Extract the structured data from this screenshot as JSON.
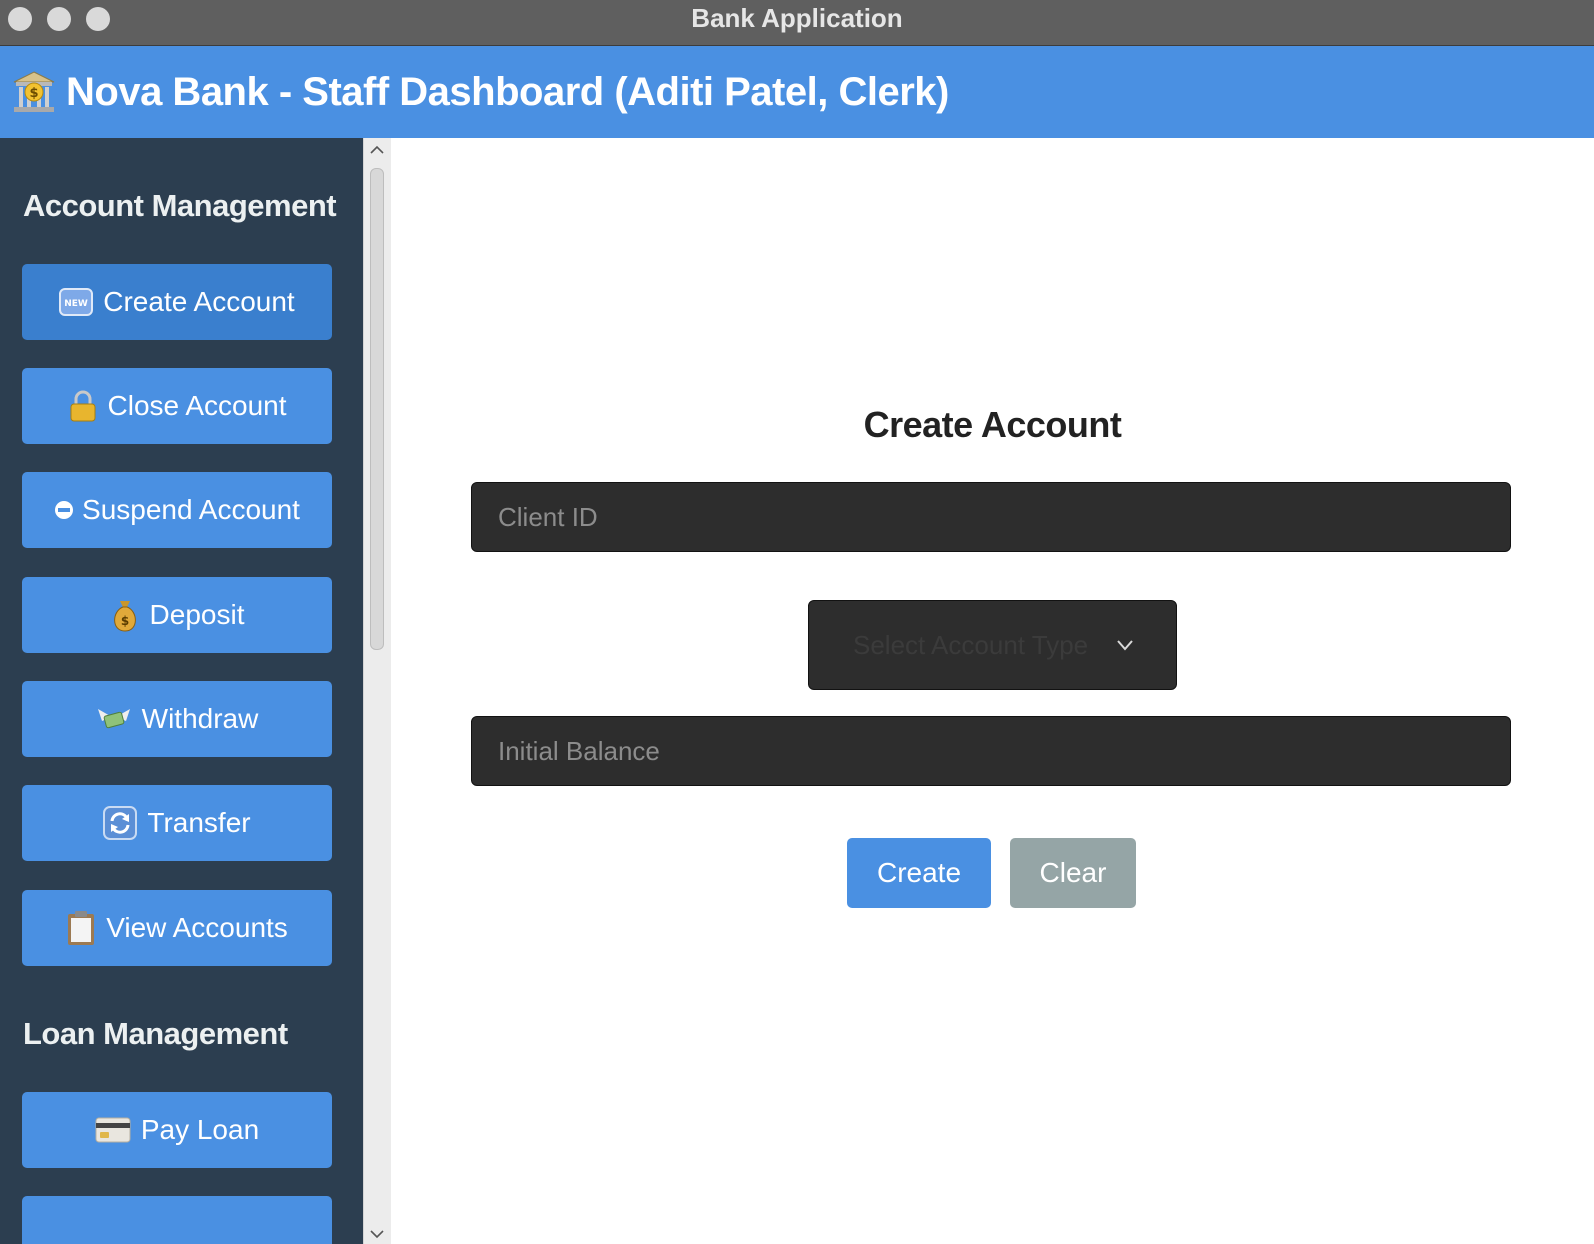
{
  "window": {
    "title": "Bank Application"
  },
  "header": {
    "title": "Nova Bank - Staff Dashboard (Aditi Patel, Clerk)",
    "icon": "bank-icon"
  },
  "sidebar": {
    "account_section_title": "Account Management",
    "account_items": [
      {
        "label": "Create Account",
        "icon": "new-icon",
        "active": true
      },
      {
        "label": "Close Account",
        "icon": "lock-icon"
      },
      {
        "label": "Suspend Account",
        "icon": "no-entry-icon"
      },
      {
        "label": "Deposit",
        "icon": "money-bag-icon"
      },
      {
        "label": "Withdraw",
        "icon": "money-wings-icon"
      },
      {
        "label": "Transfer",
        "icon": "transfer-arrows-icon"
      },
      {
        "label": "View Accounts",
        "icon": "clipboard-icon"
      }
    ],
    "loan_section_title": "Loan Management",
    "loan_items": [
      {
        "label": "Pay Loan",
        "icon": "credit-card-icon"
      }
    ]
  },
  "form": {
    "title": "Create Account",
    "client_id_placeholder": "Client ID",
    "account_type_placeholder": "Select Account Type",
    "initial_balance_placeholder": "Initial Balance",
    "create_label": "Create",
    "clear_label": "Clear"
  },
  "colors": {
    "header": "#4a90e2",
    "sidebar": "#2c3e50",
    "primary_button": "#4a90e2",
    "secondary_button": "#95a5a6",
    "field_background": "#2d2d2d"
  }
}
